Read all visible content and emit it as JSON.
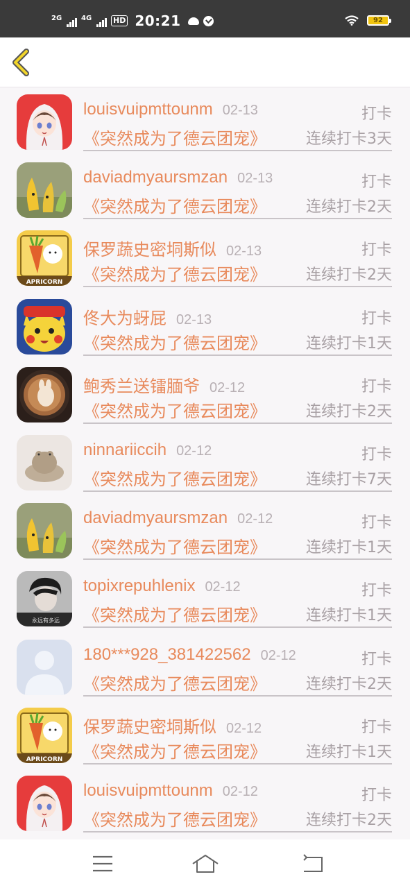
{
  "status_bar": {
    "signal1_label": "2G",
    "signal2_label": "4G",
    "hd_label": "HD",
    "time": "20:21",
    "battery": "92"
  },
  "nav": {
    "back_icon": "chevron-left-icon"
  },
  "colors": {
    "accent": "#e88a5c",
    "muted": "#a8a0a4",
    "back_arrow": "#f1c40f"
  },
  "entries": [
    {
      "avatar": "anime-girl",
      "user": "louisvuipmttounm",
      "date": "02-13",
      "action": "打卡",
      "book": "《突然成为了德云团宠》",
      "streak": "连续打卡3天"
    },
    {
      "avatar": "banana",
      "user": "daviadmyaursmzan",
      "date": "02-13",
      "action": "打卡",
      "book": "《突然成为了德云团宠》",
      "streak": "连续打卡2天"
    },
    {
      "avatar": "carrot",
      "user": "保罗蔬史密垌斯似",
      "date": "02-13",
      "action": "打卡",
      "book": "《突然成为了德云团宠》",
      "streak": "连续打卡2天"
    },
    {
      "avatar": "pikachu",
      "user": "佟大为蚜屁",
      "date": "02-13",
      "action": "打卡",
      "book": "《突然成为了德云团宠》",
      "streak": "连续打卡1天"
    },
    {
      "avatar": "coffee",
      "user": "鲍秀兰送镭腼爷",
      "date": "02-12",
      "action": "打卡",
      "book": "《突然成为了德云团宠》",
      "streak": "连续打卡2天"
    },
    {
      "avatar": "frog",
      "user": "ninnariiccih",
      "date": "02-12",
      "action": "打卡",
      "book": "《突然成为了德云团宠》",
      "streak": "连续打卡7天"
    },
    {
      "avatar": "banana",
      "user": "daviadmyaursmzan",
      "date": "02-12",
      "action": "打卡",
      "book": "《突然成为了德云团宠》",
      "streak": "连续打卡1天"
    },
    {
      "avatar": "boy",
      "user": "topixrepuhlenix",
      "date": "02-12",
      "action": "打卡",
      "book": "《突然成为了德云团宠》",
      "streak": "连续打卡1天"
    },
    {
      "avatar": "default",
      "user": "180***928_381422562",
      "date": "02-12",
      "action": "打卡",
      "book": "《突然成为了德云团宠》",
      "streak": "连续打卡2天"
    },
    {
      "avatar": "carrot",
      "user": "保罗蔬史密垌斯似",
      "date": "02-12",
      "action": "打卡",
      "book": "《突然成为了德云团宠》",
      "streak": "连续打卡1天"
    },
    {
      "avatar": "anime-girl",
      "user": "louisvuipmttounm",
      "date": "02-12",
      "action": "打卡",
      "book": "《突然成为了德云团宠》",
      "streak": "连续打卡2天"
    }
  ],
  "avatar_text": {
    "boy": "永远有多远",
    "carrot": "APRICORN"
  },
  "system_nav": {
    "menu_icon": "menu-icon",
    "home_icon": "home-icon",
    "back_icon": "back-icon"
  }
}
